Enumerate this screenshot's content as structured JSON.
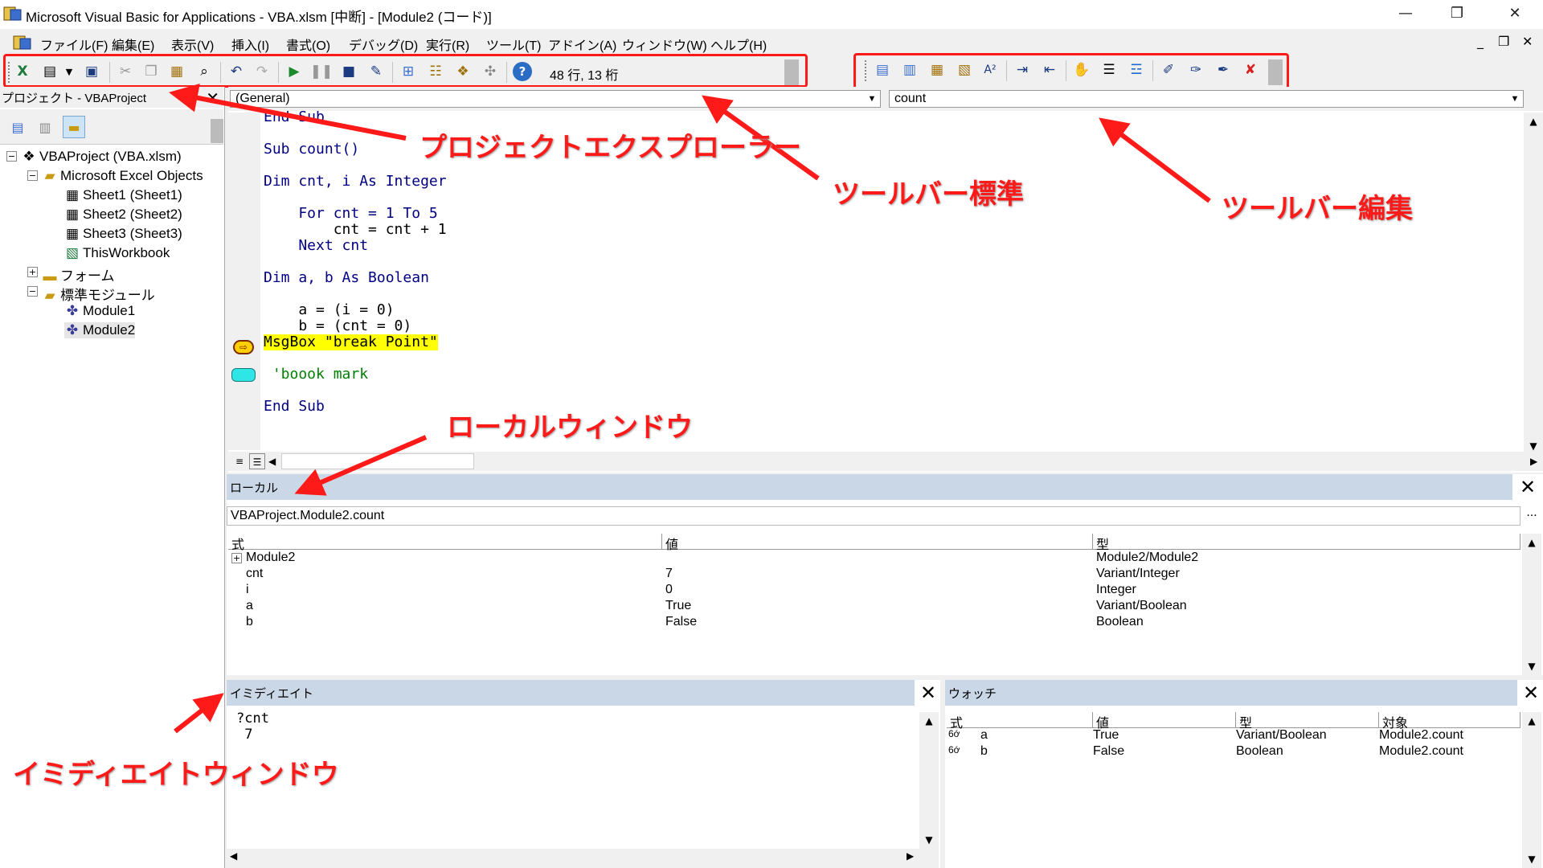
{
  "window": {
    "title": "Microsoft Visual Basic for Applications - VBA.xlsm [中断] - [Module2 (コード)]",
    "minimize": "—",
    "maximize": "❐",
    "close": "✕"
  },
  "menu": {
    "items": [
      "ファイル(F)",
      "編集(E)",
      "表示(V)",
      "挿入(I)",
      "書式(O)",
      "デバッグ(D)",
      "実行(R)",
      "ツール(T)",
      "アドイン(A)",
      "ウィンドウ(W)",
      "ヘルプ(H)"
    ],
    "mdi_minimize": "_",
    "mdi_restore": "❐",
    "mdi_close": "✕"
  },
  "toolbar_standard": {
    "cursor_position": "48 行, 13 桁",
    "icons": [
      "excel-icon",
      "insert-userform-icon",
      "save-icon",
      "cut-icon",
      "copy-icon",
      "paste-icon",
      "find-icon",
      "undo-icon",
      "redo-icon",
      "run-icon",
      "break-icon",
      "reset-icon",
      "design-mode-icon",
      "project-explorer-icon",
      "properties-icon",
      "object-browser-icon",
      "toolbox-icon",
      "help-icon"
    ]
  },
  "toolbar_edit": {
    "icons": [
      "list-properties-icon",
      "list-constants-icon",
      "quick-info-icon",
      "parameter-info-icon",
      "complete-word-icon",
      "indent-icon",
      "outdent-icon",
      "toggle-breakpoint-icon",
      "comment-block-icon",
      "uncomment-block-icon",
      "toggle-bookmark-icon",
      "next-bookmark-icon",
      "previous-bookmark-icon",
      "clear-bookmarks-icon"
    ]
  },
  "project": {
    "title": "プロジェクト - VBAProject",
    "tree": [
      {
        "label": "VBAProject (VBA.xlsm)",
        "icon": "vbaproject-icon",
        "toggle": "−"
      },
      {
        "label": "Microsoft Excel Objects",
        "icon": "folder-open-icon",
        "toggle": "−"
      },
      {
        "label": "Sheet1 (Sheet1)",
        "icon": "sheet-icon"
      },
      {
        "label": "Sheet2 (Sheet2)",
        "icon": "sheet-icon"
      },
      {
        "label": "Sheet3 (Sheet3)",
        "icon": "sheet-icon"
      },
      {
        "label": "ThisWorkbook",
        "icon": "workbook-icon"
      },
      {
        "label": "フォーム",
        "icon": "folder-icon",
        "toggle": "+"
      },
      {
        "label": "標準モジュール",
        "icon": "folder-open-icon",
        "toggle": "−"
      },
      {
        "label": "Module1",
        "icon": "module-icon"
      },
      {
        "label": "Module2",
        "icon": "module-icon"
      }
    ]
  },
  "code": {
    "object_combo": "(General)",
    "procedure_combo": "count",
    "lines": [
      {
        "text": "End Sub",
        "cls": "kw"
      },
      {
        "text": "Sub count()",
        "cls": "kw"
      },
      {
        "text": "Dim cnt, i As Integer",
        "cls": "kw"
      },
      {
        "text": "    For cnt = 1 To 5",
        "cls": "kw"
      },
      {
        "text": "        cnt = cnt + 1",
        "cls": "plain"
      },
      {
        "text": "    Next cnt",
        "cls": "kw"
      },
      {
        "text": "Dim a, b As Boolean",
        "cls": "kw"
      },
      {
        "text": "    a = (i = 0)",
        "cls": "plain"
      },
      {
        "text": "    b = (cnt = 0)",
        "cls": "plain"
      },
      {
        "text": "MsgBox \"break Point\"",
        "cls": "hl"
      },
      {
        "text": " 'boook mark",
        "cls": "cmt"
      },
      {
        "text": "End Sub",
        "cls": "kw"
      }
    ]
  },
  "locals": {
    "title": "ローカル",
    "context": "VBAProject.Module2.count",
    "headers": [
      "式",
      "値",
      "型"
    ],
    "rows": [
      [
        "Module2",
        "",
        "Module2/Module2"
      ],
      [
        "cnt",
        "7",
        "Variant/Integer"
      ],
      [
        "i",
        "0",
        "Integer"
      ],
      [
        "a",
        "True",
        "Variant/Boolean"
      ],
      [
        "b",
        "False",
        "Boolean"
      ]
    ]
  },
  "immediate": {
    "title": "イミディエイト",
    "text": "?cnt\n 7"
  },
  "watch": {
    "title": "ウォッチ",
    "headers": [
      "式",
      "値",
      "型",
      "対象"
    ],
    "rows": [
      [
        "a",
        "True",
        "Variant/Boolean",
        "Module2.count"
      ],
      [
        "b",
        "False",
        "Boolean",
        "Module2.count"
      ]
    ]
  },
  "annotations": {
    "project_explorer": "プロジェクトエクスプローラー",
    "toolbar_standard": "ツールバー標準",
    "toolbar_edit": "ツールバー編集",
    "locals_window": "ローカルウィンドウ",
    "immediate_window": "イミディエイトウィンドウ",
    "color": "#ff1a1a"
  }
}
